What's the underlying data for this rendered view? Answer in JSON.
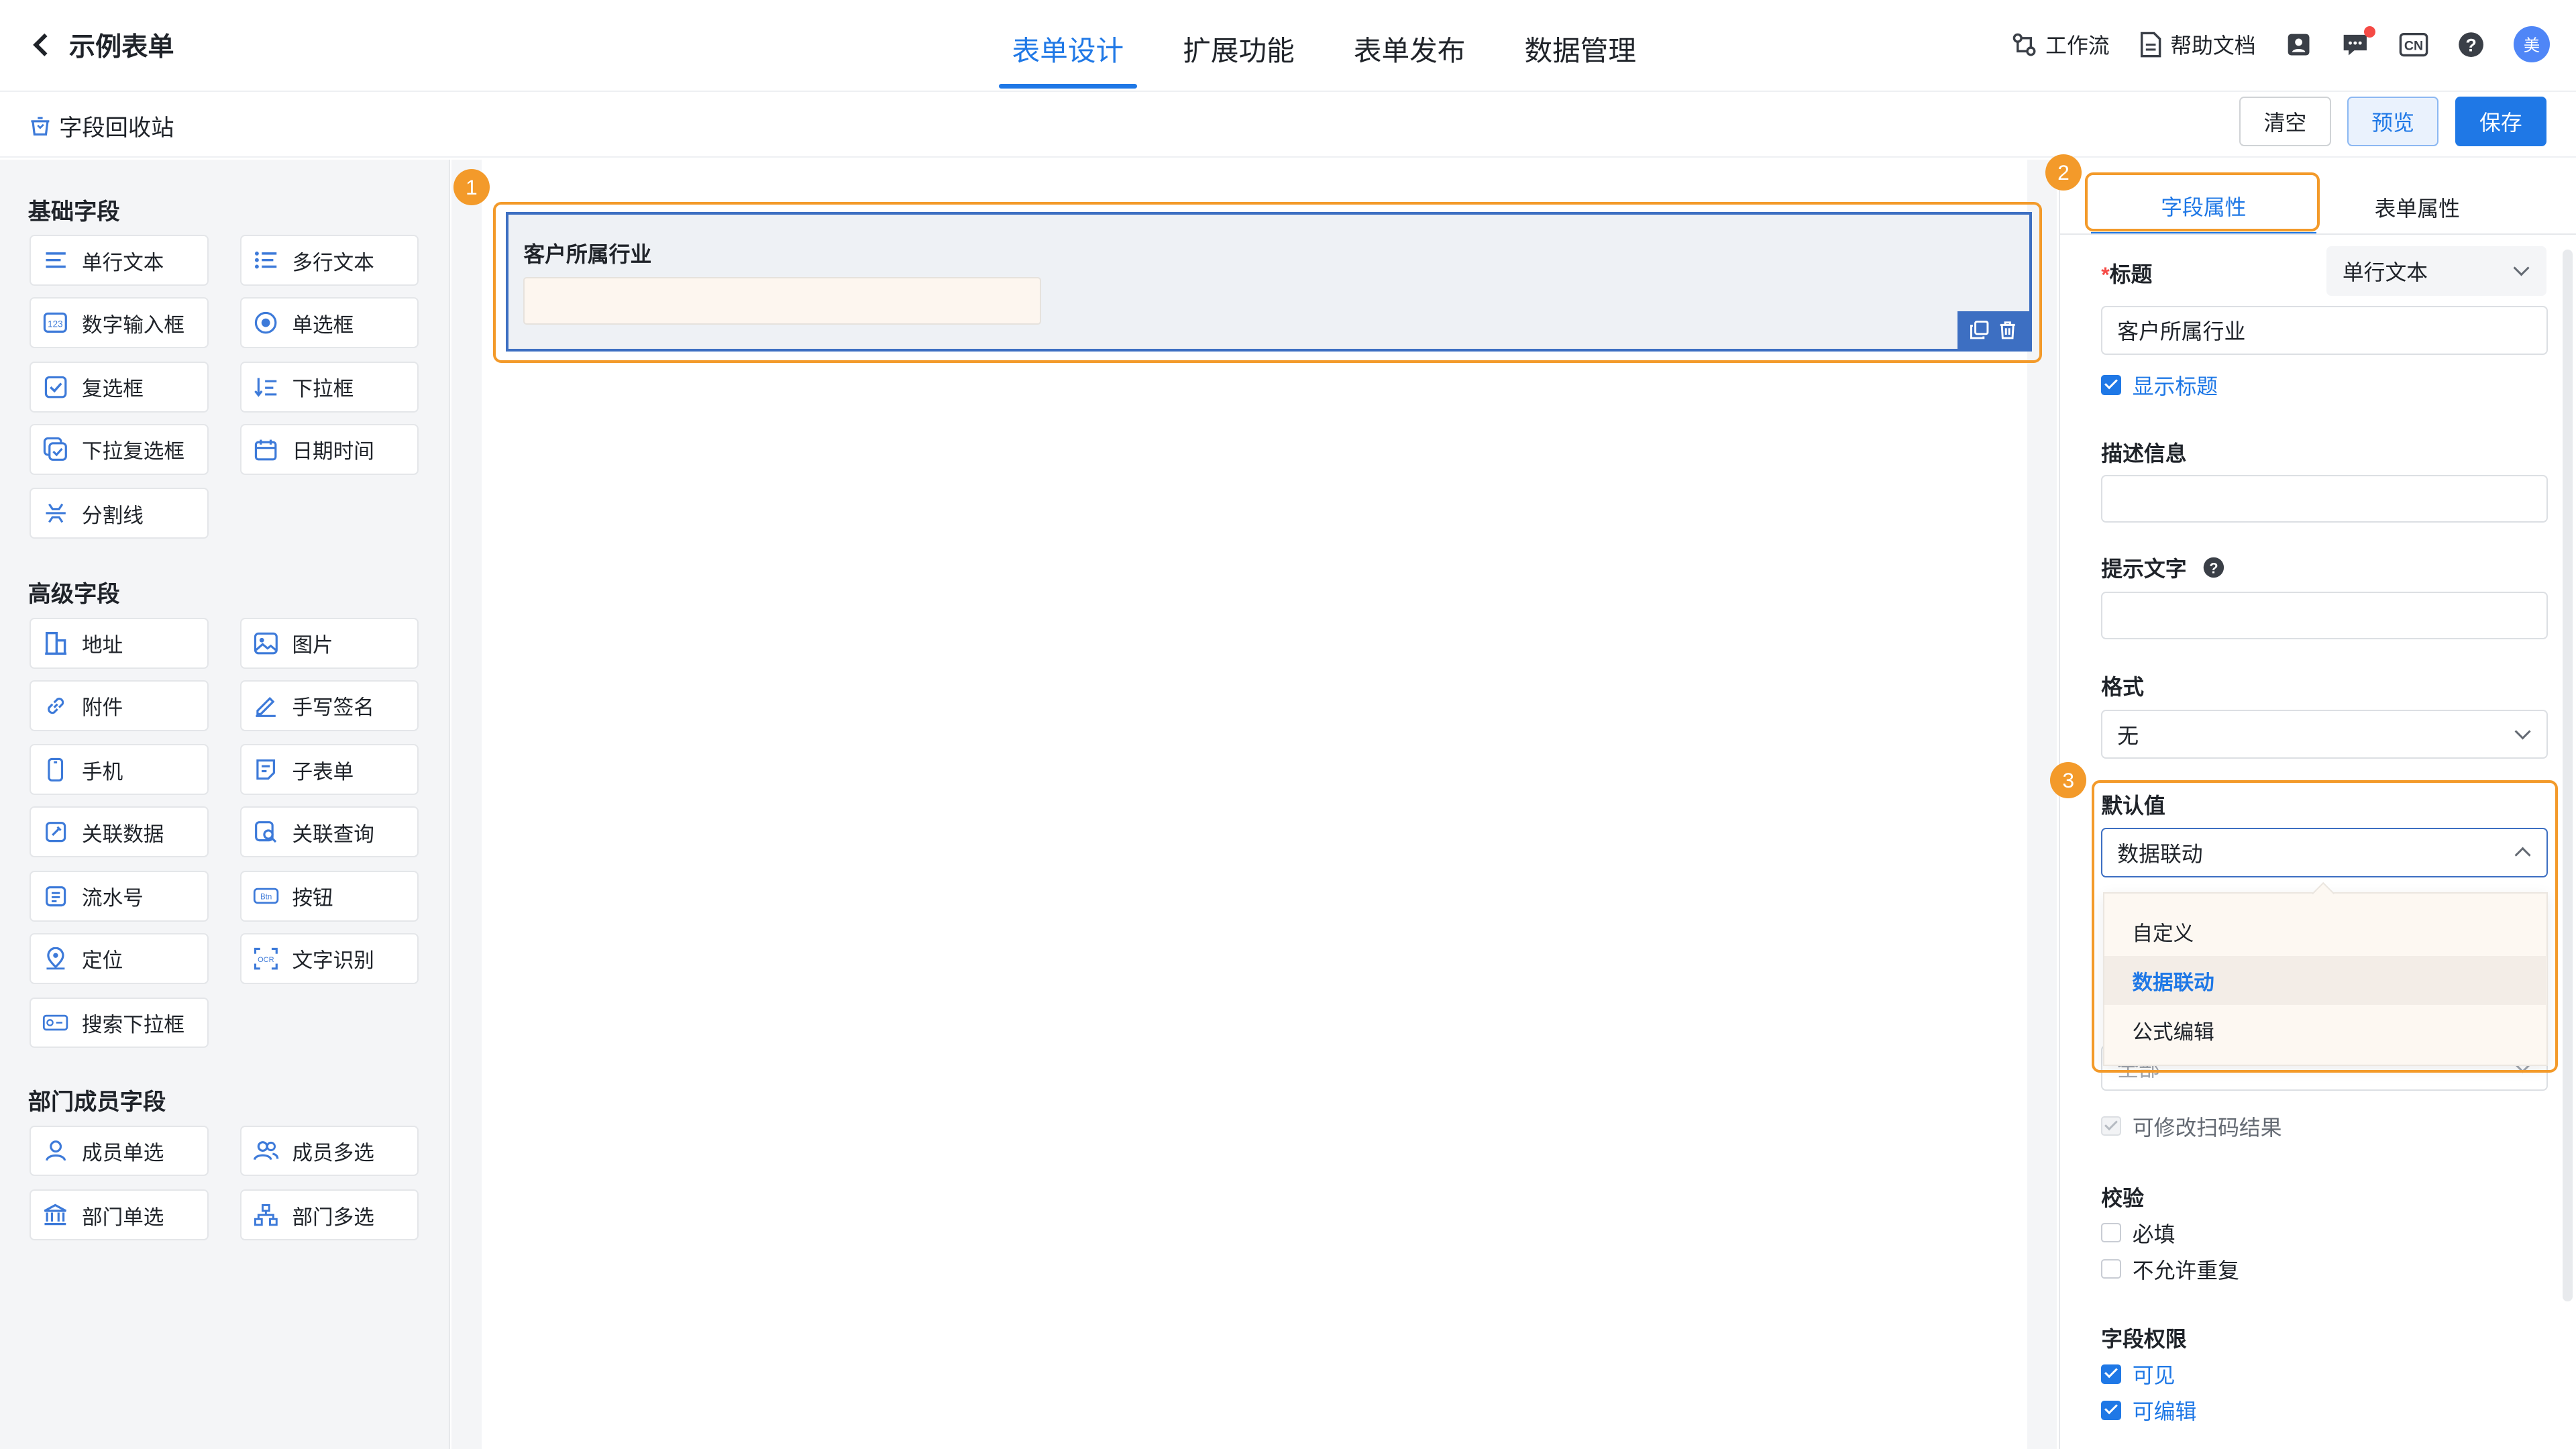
{
  "header": {
    "back_label": "示例表单",
    "tabs": [
      "表单设计",
      "扩展功能",
      "表单发布",
      "数据管理"
    ],
    "workflow": "工作流",
    "help_docs": "帮助文档",
    "lang": "CN",
    "avatar_text": "美"
  },
  "toolbar": {
    "recycle": "字段回收站",
    "clear": "清空",
    "preview": "预览",
    "save": "保存"
  },
  "left": {
    "basic_title": "基础字段",
    "basic": [
      "单行文本",
      "多行文本",
      "数字输入框",
      "单选框",
      "复选框",
      "下拉框",
      "下拉复选框",
      "日期时间",
      "分割线"
    ],
    "advanced_title": "高级字段",
    "advanced": [
      "地址",
      "图片",
      "附件",
      "手写签名",
      "手机",
      "子表单",
      "关联数据",
      "关联查询",
      "流水号",
      "按钮",
      "定位",
      "文字识别",
      "搜索下拉框"
    ],
    "dept_title": "部门成员字段",
    "dept": [
      "成员单选",
      "成员多选",
      "部门单选",
      "部门多选"
    ]
  },
  "canvas": {
    "field_label": "客户所属行业"
  },
  "markers": [
    "1",
    "2",
    "3"
  ],
  "right": {
    "tab_field": "字段属性",
    "tab_form": "表单属性",
    "title_label": "标题",
    "required_mark": "*",
    "type_value": "单行文本",
    "title_value": "客户所属行业",
    "show_title": "显示标题",
    "desc_label": "描述信息",
    "hint_label": "提示文字",
    "format_label": "格式",
    "format_value": "无",
    "default_label": "默认值",
    "default_value": "数据联动",
    "options": [
      "自定义",
      "数据联动",
      "公式编辑"
    ],
    "hidden_value": "全部",
    "scan_edit": "可修改扫码结果",
    "validate_label": "校验",
    "required": "必填",
    "no_dup": "不允许重复",
    "perm_label": "字段权限",
    "visible": "可见",
    "editable": "可编辑"
  },
  "colors": {
    "accent": "#1f78e6",
    "highlight": "#f39a2a"
  }
}
